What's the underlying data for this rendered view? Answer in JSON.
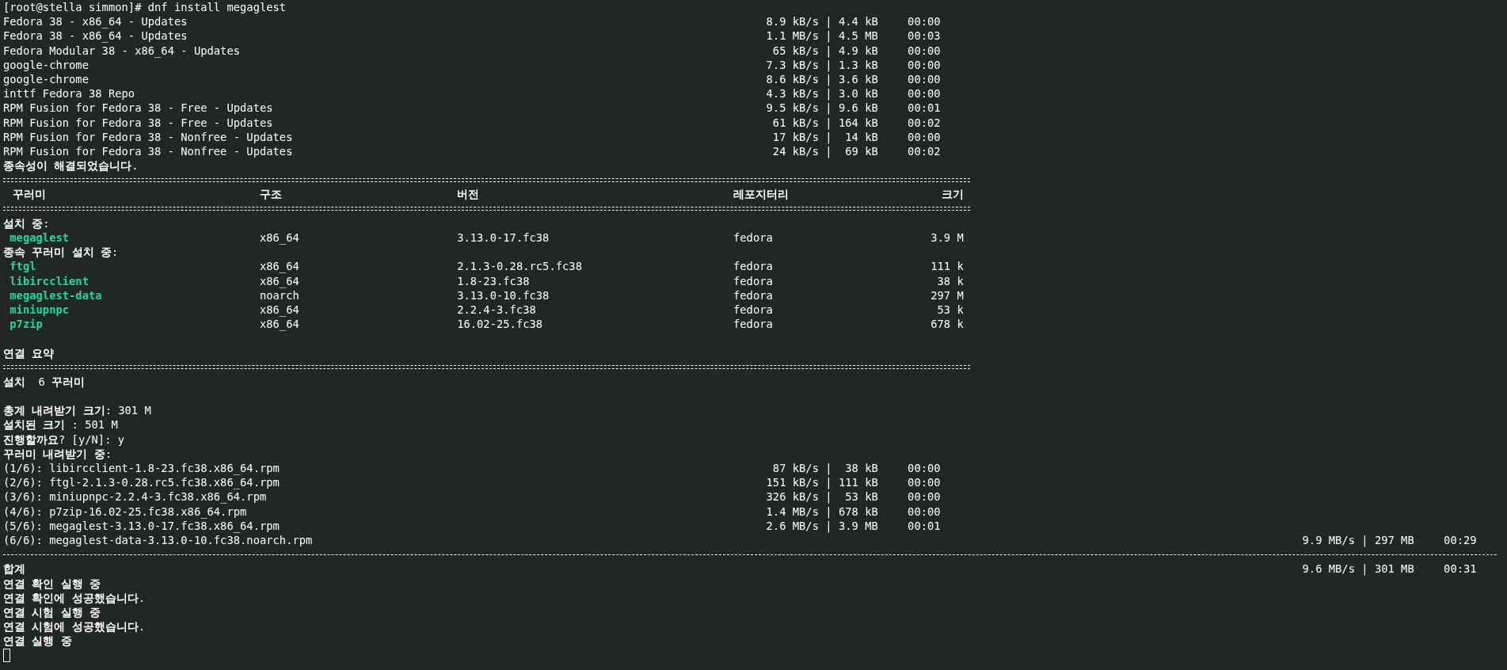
{
  "prompt": "[root@stella simmon]# dnf install megaglest",
  "lines": [
    {
      "kind": "repo",
      "name": "Fedora 38 - x86_64 - Updates",
      "transfer": "8.9 kB/s | 4.4 kB",
      "time": "00:00"
    },
    {
      "kind": "repo",
      "name": "Fedora 38 - x86_64 - Updates",
      "transfer": "1.1 MB/s | 4.5 MB",
      "time": "00:03"
    },
    {
      "kind": "repo",
      "name": "Fedora Modular 38 - x86_64 - Updates",
      "transfer": " 65 kB/s | 4.9 kB",
      "time": "00:00"
    },
    {
      "kind": "repo",
      "name": "google-chrome",
      "transfer": "7.3 kB/s | 1.3 kB",
      "time": "00:00"
    },
    {
      "kind": "repo",
      "name": "google-chrome",
      "transfer": "8.6 kB/s | 3.6 kB",
      "time": "00:00"
    },
    {
      "kind": "repo",
      "name": "inttf Fedora 38 Repo",
      "transfer": "4.3 kB/s | 3.0 kB",
      "time": "00:00"
    },
    {
      "kind": "repo",
      "name": "RPM Fusion for Fedora 38 - Free - Updates",
      "transfer": "9.5 kB/s | 9.6 kB",
      "time": "00:01"
    },
    {
      "kind": "repo",
      "name": "RPM Fusion for Fedora 38 - Free - Updates",
      "transfer": " 61 kB/s | 164 kB",
      "time": "00:02"
    },
    {
      "kind": "repo",
      "name": "RPM Fusion for Fedora 38 - Nonfree - Updates",
      "transfer": " 17 kB/s |  14 kB",
      "time": "00:00"
    },
    {
      "kind": "repo",
      "name": "RPM Fusion for Fedora 38 - Nonfree - Updates",
      "transfer": " 24 kB/s |  69 kB",
      "time": "00:02"
    },
    {
      "kind": "text",
      "text": "**종속성이 해결되었습니다**."
    },
    {
      "kind": "double_rule"
    },
    {
      "kind": "header",
      "cells": [
        "꾸러미",
        "구조",
        "버전",
        "레포지터리",
        "크기"
      ]
    },
    {
      "kind": "double_rule"
    },
    {
      "kind": "text",
      "text": "**설치 중**:"
    },
    {
      "kind": "package",
      "cells": [
        "megaglest",
        "x86_64",
        "3.13.0-17.fc38",
        "fedora",
        "3.9 M"
      ]
    },
    {
      "kind": "text",
      "text": "**종속 꾸러미 설치 중**:"
    },
    {
      "kind": "package",
      "cells": [
        "ftgl",
        "x86_64",
        "2.1.3-0.28.rc5.fc38",
        "fedora",
        "111 k"
      ]
    },
    {
      "kind": "package",
      "cells": [
        "libircclient",
        "x86_64",
        "1.8-23.fc38",
        "fedora",
        "38 k"
      ]
    },
    {
      "kind": "package",
      "cells": [
        "megaglest-data",
        "noarch",
        "3.13.0-10.fc38",
        "fedora",
        "297 M"
      ]
    },
    {
      "kind": "package",
      "cells": [
        "miniupnpc",
        "x86_64",
        "2.2.4-3.fc38",
        "fedora",
        "53 k"
      ]
    },
    {
      "kind": "package",
      "cells": [
        "p7zip",
        "x86_64",
        "16.02-25.fc38",
        "fedora",
        "678 k"
      ]
    },
    {
      "kind": "blank"
    },
    {
      "kind": "text",
      "text": "**연결 요약**"
    },
    {
      "kind": "double_rule"
    },
    {
      "kind": "text",
      "text": "**설치**  6 **꾸러미**"
    },
    {
      "kind": "blank"
    },
    {
      "kind": "text",
      "text": "**총계 내려받기 크기**: 301 M"
    },
    {
      "kind": "text",
      "text": "**설치된 크기** : 501 M"
    },
    {
      "kind": "text",
      "text": "**진행할까요**? [y/N]: y"
    },
    {
      "kind": "text",
      "text": "**꾸러미 내려받기 중**:"
    },
    {
      "kind": "download",
      "wide": false,
      "name": "(1/6): libircclient-1.8-23.fc38.x86_64.rpm",
      "transfer": " 87 kB/s |  38 kB",
      "time": "00:00"
    },
    {
      "kind": "download",
      "wide": false,
      "name": "(2/6): ftgl-2.1.3-0.28.rc5.fc38.x86_64.rpm",
      "transfer": "151 kB/s | 111 kB",
      "time": "00:00"
    },
    {
      "kind": "download",
      "wide": false,
      "name": "(3/6): miniupnpc-2.2.4-3.fc38.x86_64.rpm",
      "transfer": "326 kB/s |  53 kB",
      "time": "00:00"
    },
    {
      "kind": "download",
      "wide": false,
      "name": "(4/6): p7zip-16.02-25.fc38.x86_64.rpm",
      "transfer": "1.4 MB/s | 678 kB",
      "time": "00:00"
    },
    {
      "kind": "download",
      "wide": false,
      "name": "(5/6): megaglest-3.13.0-17.fc38.x86_64.rpm",
      "transfer": "2.6 MB/s | 3.9 MB",
      "time": "00:01"
    },
    {
      "kind": "download",
      "wide": true,
      "name": "(6/6): megaglest-data-3.13.0-10.fc38.noarch.rpm",
      "transfer": "9.9 MB/s | 297 MB",
      "time": "00:29"
    },
    {
      "kind": "dashed_rule"
    },
    {
      "kind": "download",
      "wide": true,
      "name": "**합계**",
      "transfer": "9.6 MB/s | 301 MB",
      "time": "00:31"
    },
    {
      "kind": "text",
      "text": "**연결 확인 실행 중**"
    },
    {
      "kind": "text",
      "text": "**연결 확인에 성공했습니다**."
    },
    {
      "kind": "text",
      "text": "**연결 시험 실행 중**"
    },
    {
      "kind": "text",
      "text": "**연결 시험에 성공했습니다**."
    },
    {
      "kind": "text",
      "text": "**연결 실행 중**"
    },
    {
      "kind": "cursor"
    }
  ]
}
